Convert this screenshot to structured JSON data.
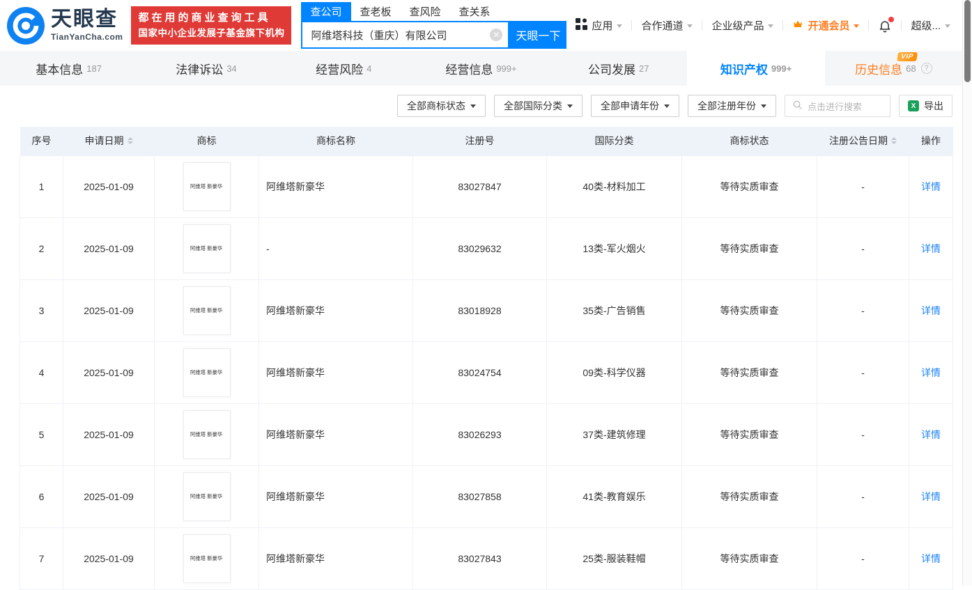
{
  "header": {
    "logo": {
      "title": "天眼查",
      "subtitle": "TianYanCha.com"
    },
    "banner": {
      "line1": "都在用的商业查询工具",
      "line2": "国家中小企业发展子基金旗下机构"
    },
    "search": {
      "tabs": [
        {
          "label": "查公司",
          "active": true
        },
        {
          "label": "查老板",
          "active": false
        },
        {
          "label": "查风险",
          "active": false
        },
        {
          "label": "查关系",
          "active": false
        }
      ],
      "value": "阿维塔科技（重庆）有限公司",
      "button_label": "天眼一下"
    },
    "nav": [
      {
        "label": "应用",
        "icon": "grid-icon",
        "caret": true,
        "vip": false,
        "bell": false
      },
      {
        "label": "合作通道",
        "icon": "",
        "caret": true,
        "vip": false,
        "bell": false
      },
      {
        "label": "企业级产品",
        "icon": "",
        "caret": true,
        "vip": false,
        "bell": false
      },
      {
        "label": "开通会员",
        "icon": "crown-icon",
        "caret": true,
        "vip": true,
        "bell": false
      },
      {
        "label": "",
        "icon": "bell-icon",
        "caret": false,
        "vip": false,
        "bell": true
      },
      {
        "label": "超级...",
        "icon": "",
        "caret": true,
        "vip": false,
        "bell": false
      }
    ]
  },
  "company_tabs": [
    {
      "label": "基本信息",
      "count": "187",
      "active": false,
      "vip": false,
      "help": false
    },
    {
      "label": "法律诉讼",
      "count": "34",
      "active": false,
      "vip": false,
      "help": false
    },
    {
      "label": "经营风险",
      "count": "4",
      "active": false,
      "vip": false,
      "help": false
    },
    {
      "label": "经营信息",
      "count": "999+",
      "active": false,
      "vip": false,
      "help": false
    },
    {
      "label": "公司发展",
      "count": "27",
      "active": false,
      "vip": false,
      "help": false
    },
    {
      "label": "知识产权",
      "count": "999+",
      "active": true,
      "vip": false,
      "help": false
    },
    {
      "label": "历史信息",
      "count": "68",
      "active": false,
      "vip": true,
      "vip_badge": "VIP",
      "help": true,
      "help_glyph": "?"
    }
  ],
  "filters": {
    "dropdowns": [
      "全部商标状态",
      "全部国际分类",
      "全部申请年份",
      "全部注册年份"
    ],
    "search_placeholder": "点击进行搜索",
    "export_label": "导出"
  },
  "table": {
    "columns": [
      "序号",
      "申请日期",
      "商标",
      "商标名称",
      "注册号",
      "国际分类",
      "商标状态",
      "注册公告日期",
      "操作"
    ],
    "sortable_columns": [
      "申请日期",
      "注册公告日期"
    ],
    "action_label": "详情",
    "trademark_image_text": "阿维塔 新豪华",
    "rows": [
      {
        "idx": "1",
        "date": "2025-01-09",
        "name": "阿维塔新豪华",
        "reg_no": "83027847",
        "intl_class": "40类-材料加工",
        "status": "等待实质审查",
        "pub_date": "-"
      },
      {
        "idx": "2",
        "date": "2025-01-09",
        "name": "-",
        "reg_no": "83029632",
        "intl_class": "13类-军火烟火",
        "status": "等待实质审查",
        "pub_date": "-"
      },
      {
        "idx": "3",
        "date": "2025-01-09",
        "name": "阿维塔新豪华",
        "reg_no": "83018928",
        "intl_class": "35类-广告销售",
        "status": "等待实质审查",
        "pub_date": "-"
      },
      {
        "idx": "4",
        "date": "2025-01-09",
        "name": "阿维塔新豪华",
        "reg_no": "83024754",
        "intl_class": "09类-科学仪器",
        "status": "等待实质审查",
        "pub_date": "-"
      },
      {
        "idx": "5",
        "date": "2025-01-09",
        "name": "阿维塔新豪华",
        "reg_no": "83026293",
        "intl_class": "37类-建筑修理",
        "status": "等待实质审查",
        "pub_date": "-"
      },
      {
        "idx": "6",
        "date": "2025-01-09",
        "name": "阿维塔新豪华",
        "reg_no": "83027858",
        "intl_class": "41类-教育娱乐",
        "status": "等待实质审查",
        "pub_date": "-"
      },
      {
        "idx": "7",
        "date": "2025-01-09",
        "name": "阿维塔新豪华",
        "reg_no": "83027843",
        "intl_class": "25类-服装鞋帽",
        "status": "等待实质审查",
        "pub_date": "-"
      }
    ]
  },
  "colors": {
    "brand_blue": "#0084ff",
    "banner_red": "#df3a36",
    "vip_orange": "#ff7d20",
    "link_blue": "#1c83f8",
    "excel_green": "#1aa05a"
  }
}
